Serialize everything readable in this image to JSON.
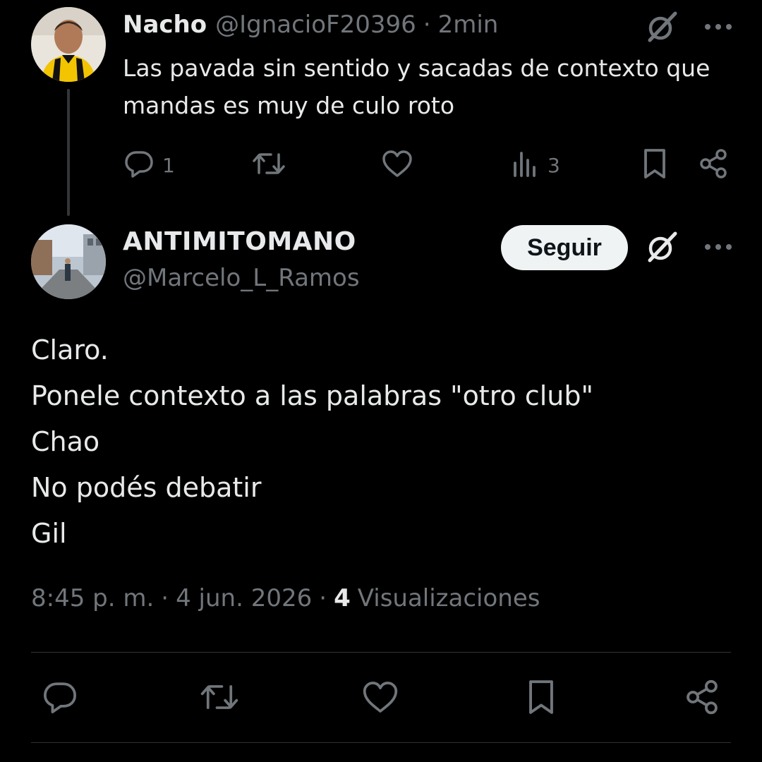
{
  "reply": {
    "name": "Nacho",
    "handle": "@IgnacioF20396",
    "separator": "·",
    "time": "2min",
    "text": "Las pavada sin sentido y sacadas de contexto que mandas es muy de culo roto",
    "actions": {
      "reply_count": "1",
      "retweet_count": "",
      "like_count": "",
      "views_count": "3"
    },
    "icons": [
      "grok-icon",
      "more-icon",
      "reply-icon",
      "retweet-icon",
      "like-icon",
      "views-icon",
      "bookmark-icon",
      "share-icon"
    ]
  },
  "main": {
    "name": "ANTIMITOMANO",
    "handle": "@Marcelo_L_Ramos",
    "follow_label": "Seguir",
    "lines": [
      "Claro.",
      "Ponele contexto a las palabras \"otro club\"",
      "Chao",
      "No podés debatir",
      "Gil"
    ],
    "time": "8:45 p. m.",
    "separator": "·",
    "date": "4 jun. 2026",
    "views_count": "4",
    "views_label": "Visualizaciones",
    "icons": [
      "reply-icon",
      "retweet-icon",
      "like-icon",
      "bookmark-icon",
      "share-icon"
    ]
  },
  "colors": {
    "background": "#000000",
    "text": "#e7e9ea",
    "muted": "#71767b",
    "divider": "#2f3336",
    "follow_bg": "#eff3f4"
  }
}
